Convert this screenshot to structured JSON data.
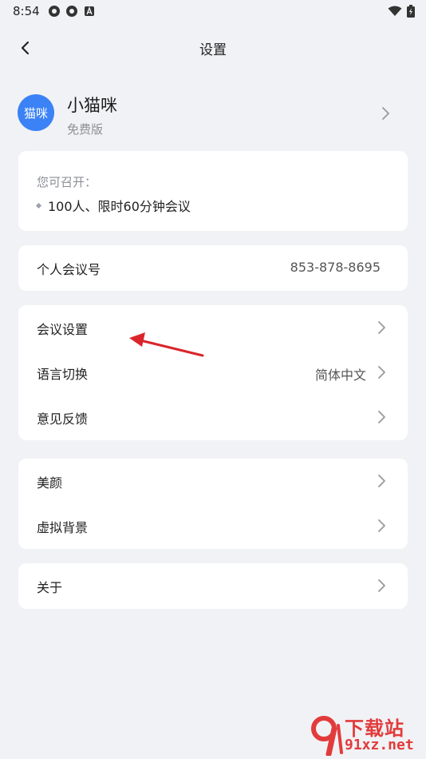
{
  "status_bar": {
    "time": "8:54"
  },
  "nav": {
    "title": "设置"
  },
  "profile": {
    "avatar_text": "猫咪",
    "name": "小猫咪",
    "plan": "免费版"
  },
  "capacity": {
    "label": "您可召开：",
    "item": "100人、限时60分钟会议"
  },
  "meeting_id": {
    "label": "个人会议号",
    "value": "853-878-8695"
  },
  "settings_group": {
    "items": [
      {
        "label": "会议设置",
        "value": ""
      },
      {
        "label": "语言切换",
        "value": "简体中文"
      },
      {
        "label": "意见反馈",
        "value": ""
      }
    ]
  },
  "beauty_group": {
    "items": [
      {
        "label": "美颜"
      },
      {
        "label": "虚拟背景"
      }
    ]
  },
  "about": {
    "label": "关于"
  },
  "watermark": {
    "line1": "下载站",
    "line2": "91xz.net"
  },
  "colors": {
    "accent": "#3b82f6",
    "background": "#f1f2f5",
    "annotation": "#d9262c"
  }
}
